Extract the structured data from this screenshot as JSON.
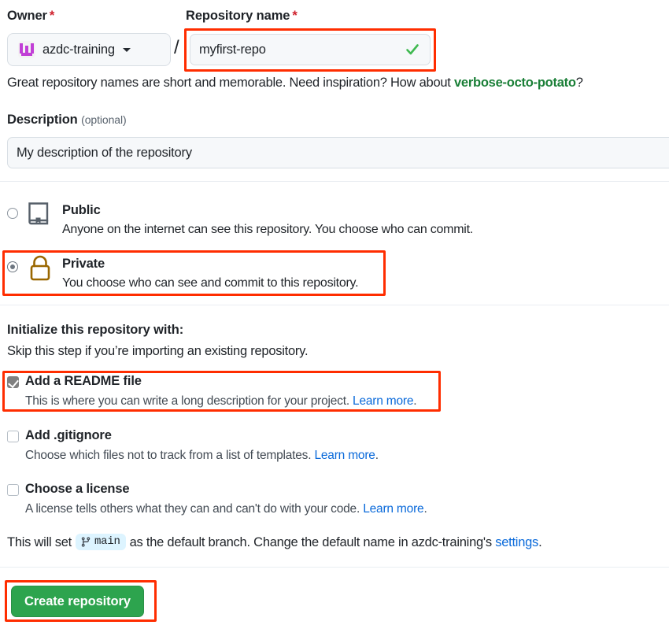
{
  "owner": {
    "label": "Owner",
    "required_mark": "*",
    "selected": "azdc-training",
    "avatar_icon": "org-avatar-icon",
    "caret_icon": "chevron-down-icon"
  },
  "separator": "/",
  "repo_name": {
    "label": "Repository name",
    "required_mark": "*",
    "value": "myfirst-repo",
    "placeholder": "",
    "valid_icon": "check-icon"
  },
  "hint": {
    "before": "Great repository names are short and memorable. Need inspiration? How about ",
    "suggestion": "verbose-octo-potato",
    "after": "?"
  },
  "description": {
    "label": "Description",
    "optional_label": "(optional)",
    "value": "My description of the repository",
    "placeholder": ""
  },
  "visibility": {
    "options": [
      {
        "id": "public",
        "title": "Public",
        "subtitle": "Anyone on the internet can see this repository. You choose who can commit.",
        "icon": "book-icon",
        "selected": false
      },
      {
        "id": "private",
        "title": "Private",
        "subtitle": "You choose who can see and commit to this repository.",
        "icon": "lock-icon",
        "selected": true
      }
    ]
  },
  "initialize": {
    "heading": "Initialize this repository with:",
    "subheading": "Skip this step if you’re importing an existing repository.",
    "options": [
      {
        "id": "readme",
        "title": "Add a README file",
        "subtitle": "This is where you can write a long description for your project. ",
        "link": "Learn more",
        "link_suffix": ".",
        "checked": true
      },
      {
        "id": "gitignore",
        "title": "Add .gitignore",
        "subtitle": "Choose which files not to track from a list of templates. ",
        "link": "Learn more",
        "link_suffix": ".",
        "checked": false
      },
      {
        "id": "license",
        "title": "Choose a license",
        "subtitle": "A license tells others what they can and can't do with your code. ",
        "link": "Learn more",
        "link_suffix": ".",
        "checked": false
      }
    ]
  },
  "default_branch": {
    "text_before": "This will set",
    "branch_name": "main",
    "branch_icon": "git-branch-icon",
    "text_middle": "as the default branch. Change the default name in azdc-training's",
    "settings_link": "settings",
    "text_after": "."
  },
  "submit": {
    "label": "Create repository"
  },
  "colors": {
    "accent_green": "#2da44e",
    "link_blue": "#0969da",
    "suggestion_green": "#1a7f37",
    "lock_gold": "#9a6700",
    "book_gray": "#57606a",
    "highlight_red": "#ff2d00",
    "checked_gray": "#808080",
    "field_bg": "#f6f8fa",
    "branch_badge_bg": "#ddf4ff"
  },
  "highlights": [
    {
      "name": "repo-name-highlight"
    },
    {
      "name": "private-option-highlight"
    },
    {
      "name": "readme-option-highlight"
    },
    {
      "name": "create-button-highlight"
    }
  ]
}
